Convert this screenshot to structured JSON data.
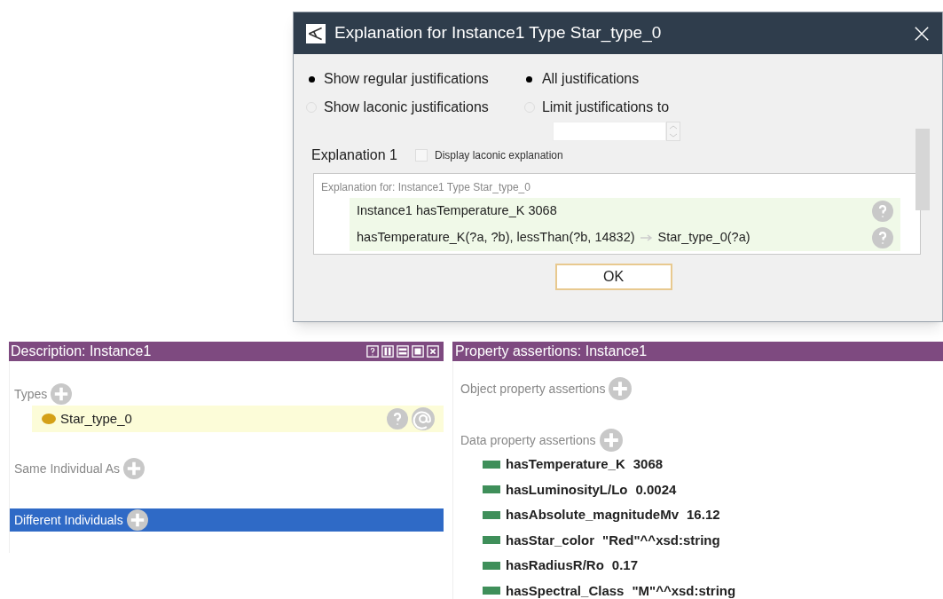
{
  "dialog": {
    "title": "Explanation for Instance1 Type Star_type_0",
    "radio_left": [
      {
        "label": "Show regular justifications",
        "selected": true
      },
      {
        "label": "Show laconic justifications",
        "selected": false
      }
    ],
    "radio_right": [
      {
        "label": "All justifications",
        "selected": true
      },
      {
        "label": "Limit justifications to",
        "selected": false
      }
    ],
    "explanation": {
      "title": "Explanation 1",
      "laconic_checkbox": {
        "label": "Display laconic explanation",
        "checked": false
      },
      "header": "Explanation for: Instance1 Type Star_type_0",
      "axioms": [
        {
          "kind": "assertion",
          "text": "Instance1 hasTemperature_K 3068"
        },
        {
          "kind": "rule",
          "body": "hasTemperature_K(?a, ?b), lessThan(?b, 14832)",
          "head": "Star_type_0(?a)"
        }
      ]
    },
    "ok_button": "OK"
  },
  "description": {
    "title": "Description: Instance1",
    "sections": [
      {
        "label": "Types",
        "items": [
          "Star_type_0"
        ],
        "selected": false
      },
      {
        "label": "Same Individual As",
        "selected": false
      },
      {
        "label": "Different Individuals",
        "selected": true
      }
    ]
  },
  "property_assertions": {
    "title": "Property assertions: Instance1",
    "object_label": "Object property assertions",
    "data_label": "Data property assertions",
    "data": [
      {
        "property": "hasTemperature_K",
        "value": "3068"
      },
      {
        "property": "hasLuminosityL/Lo",
        "value": "0.0024"
      },
      {
        "property": "hasAbsolute_magnitudeMv",
        "value": "16.12"
      },
      {
        "property": "hasStar_color",
        "value": "\"Red\"^^xsd:string"
      },
      {
        "property": "hasRadiusR/Ro",
        "value": "0.17"
      },
      {
        "property": "hasSpectral_Class",
        "value": "\"M\"^^xsd:string"
      }
    ]
  }
}
